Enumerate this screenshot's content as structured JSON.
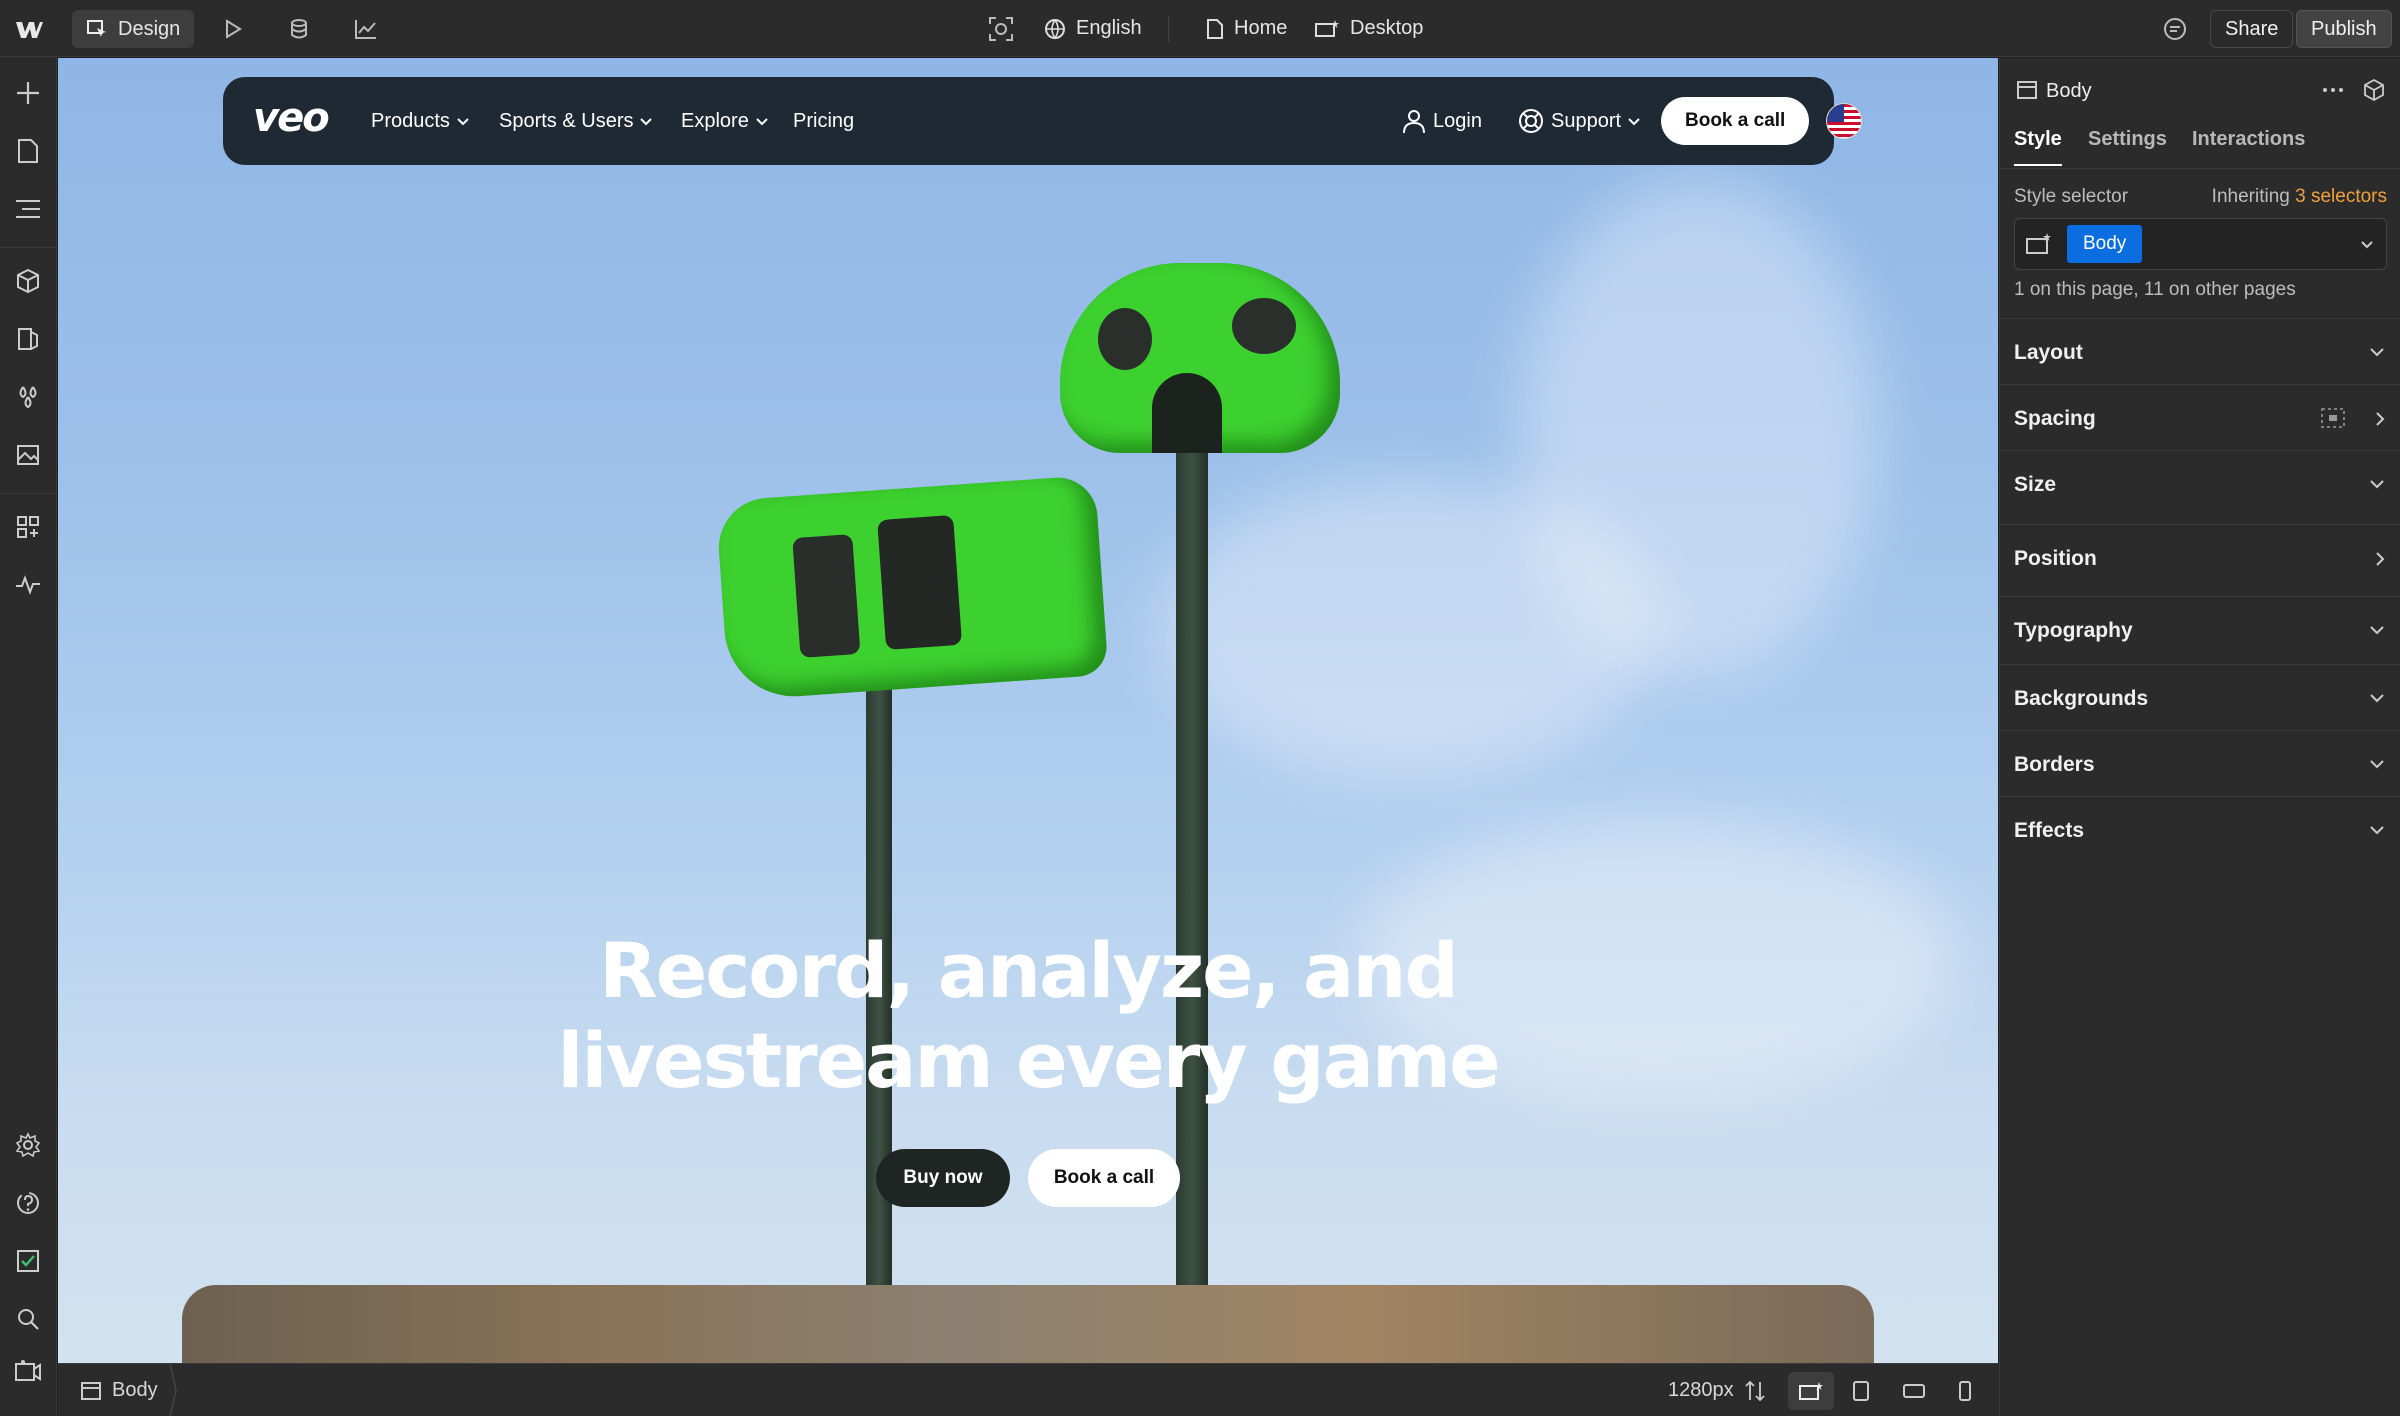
{
  "topbar": {
    "mode_label": "Design",
    "locale_label": "English",
    "page_label": "Home",
    "breakpoint_label": "Desktop",
    "share_label": "Share",
    "publish_label": "Publish"
  },
  "site": {
    "logo": "veo",
    "nav": [
      {
        "label": "Products"
      },
      {
        "label": "Sports & Users"
      },
      {
        "label": "Explore"
      },
      {
        "label": "Pricing"
      }
    ],
    "login_label": "Login",
    "support_label": "Support",
    "cta_label": "Book a call",
    "hero": {
      "line1": "Record, analyze, and",
      "line2": "livestream every game",
      "primary_button": "Buy now",
      "secondary_button": "Book a call"
    }
  },
  "panel": {
    "element_name": "Body",
    "tabs": [
      "Style",
      "Settings",
      "Interactions"
    ],
    "style_selector_label": "Style selector",
    "inheriting_prefix": "Inheriting",
    "inheriting_count": "3 selectors",
    "selector_chip": "Body",
    "usage_text": "1 on this page, 11 on other pages",
    "sections": [
      "Layout",
      "Spacing",
      "Size",
      "Position",
      "Typography",
      "Backgrounds",
      "Borders",
      "Effects"
    ]
  },
  "statusbar": {
    "breadcrumb": "Body",
    "width_label": "1280px"
  },
  "colors": {
    "accent": "#0b6ee0",
    "inherit_highlight": "#f0a03c",
    "camera_green": "#3dd12f"
  }
}
